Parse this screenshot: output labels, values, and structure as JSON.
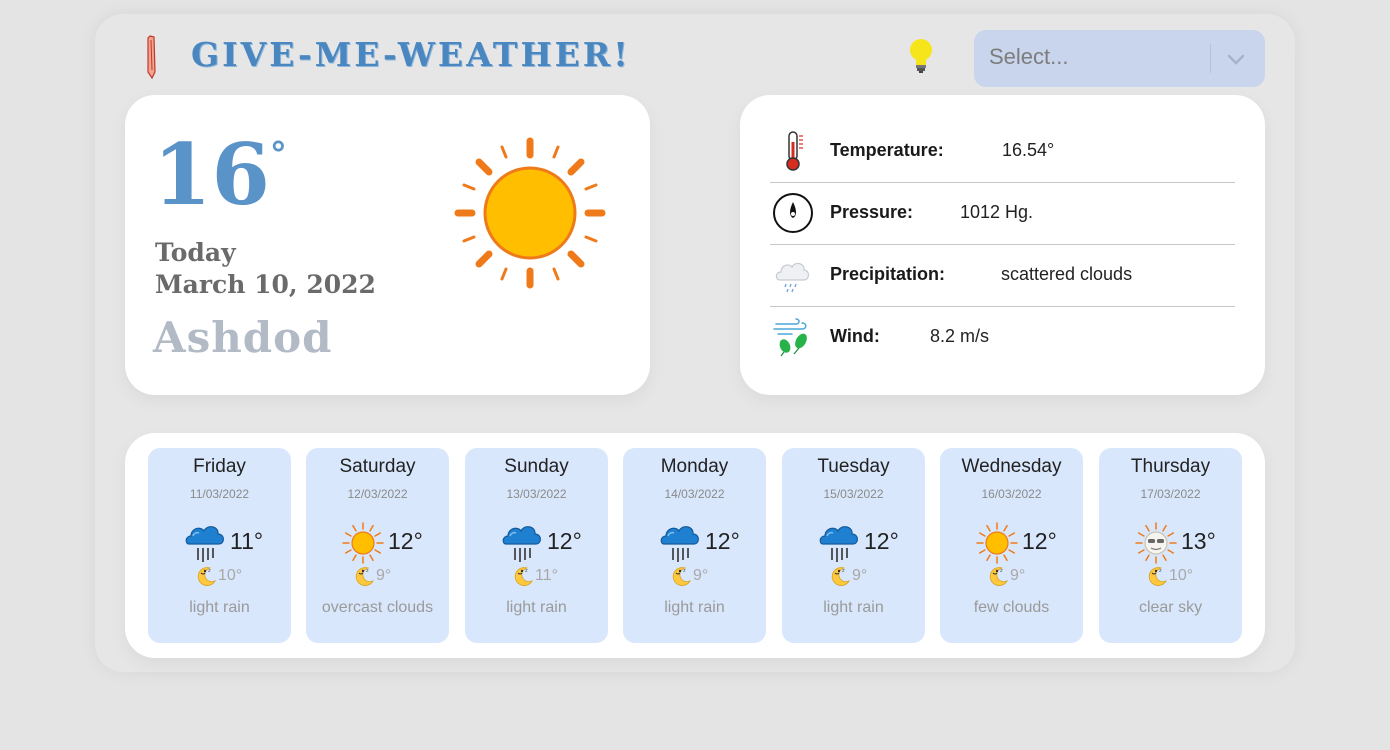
{
  "header": {
    "title": "GIVE-ME-WEATHER!",
    "select_placeholder": "Select...",
    "icons": {
      "logo": "thermometer-pencil-icon",
      "theme": "lightbulb-icon",
      "dropdown": "chevron-down-icon"
    }
  },
  "current": {
    "temp": "16",
    "deg": "°",
    "day": "Today",
    "date": "March 10, 2022",
    "city": "Ashdod",
    "icon": "sun-icon"
  },
  "details": [
    {
      "icon": "thermometer-icon",
      "label": "Temperature:",
      "value": "16.54°"
    },
    {
      "icon": "compass-icon",
      "label": "Pressure:",
      "value": "1012 Hg."
    },
    {
      "icon": "cloud-icon",
      "label": "Precipitation:",
      "value": "scattered clouds"
    },
    {
      "icon": "wind-icon",
      "label": "Wind:",
      "value": "8.2 m/s"
    }
  ],
  "forecast": [
    {
      "day": "Friday",
      "date": "11/03/2022",
      "max": "11°",
      "min": "10°",
      "desc": "light rain",
      "icon": "rain-cloud-icon"
    },
    {
      "day": "Saturday",
      "date": "12/03/2022",
      "max": "12°",
      "min": "9°",
      "desc": "overcast clouds",
      "icon": "sun-icon"
    },
    {
      "day": "Sunday",
      "date": "13/03/2022",
      "max": "12°",
      "min": "11°",
      "desc": "light rain",
      "icon": "rain-cloud-icon"
    },
    {
      "day": "Monday",
      "date": "14/03/2022",
      "max": "12°",
      "min": "9°",
      "desc": "light rain",
      "icon": "rain-cloud-icon"
    },
    {
      "day": "Tuesday",
      "date": "15/03/2022",
      "max": "12°",
      "min": "9°",
      "desc": "light rain",
      "icon": "rain-cloud-icon"
    },
    {
      "day": "Wednesday",
      "date": "16/03/2022",
      "max": "12°",
      "min": "9°",
      "desc": "few clouds",
      "icon": "sun-icon"
    },
    {
      "day": "Thursday",
      "date": "17/03/2022",
      "max": "13°",
      "min": "10°",
      "desc": "clear sky",
      "icon": "sun-sunglasses-icon"
    }
  ],
  "colors": {
    "title": "#4a86c0",
    "temp": "#5a93c8",
    "day_card": "#d9e7fc",
    "select_bg": "#c8d5ec",
    "sun": "#ffbf00",
    "sun_ray": "#ef7a1a"
  }
}
